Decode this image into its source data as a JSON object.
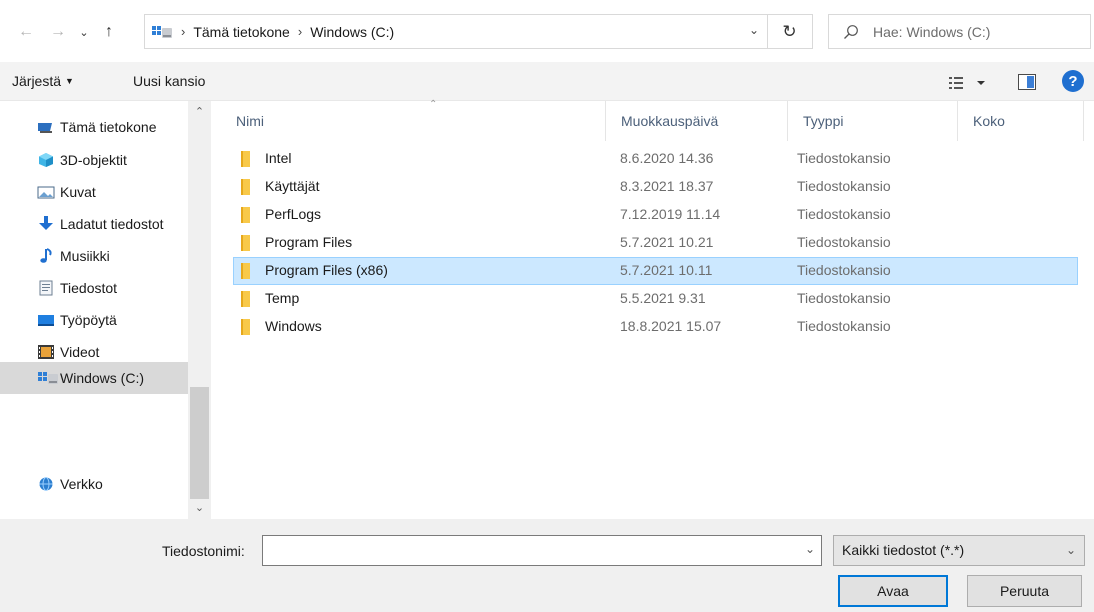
{
  "address": {
    "back_icon": "back-arrow-icon",
    "forward_icon": "forward-arrow-icon",
    "up_icon": "up-arrow-icon",
    "crumbs": [
      "Tämä tietokone",
      "Windows (C:)"
    ],
    "refresh_icon": "refresh-icon",
    "search_placeholder": "Hae: Windows (C:)"
  },
  "toolbar": {
    "organize_label": "Järjestä",
    "new_folder_label": "Uusi kansio",
    "help_label": "?"
  },
  "nav": {
    "items": [
      {
        "label": "Tämä tietokone",
        "icon": "computer-icon"
      },
      {
        "label": "3D-objektit",
        "icon": "3d-objects-icon"
      },
      {
        "label": "Kuvat",
        "icon": "pictures-icon"
      },
      {
        "label": "Ladatut tiedostot",
        "icon": "downloads-icon"
      },
      {
        "label": "Musiikki",
        "icon": "music-icon"
      },
      {
        "label": "Tiedostot",
        "icon": "documents-icon"
      },
      {
        "label": "Työpöytä",
        "icon": "desktop-icon"
      },
      {
        "label": "Videot",
        "icon": "videos-icon"
      },
      {
        "label": "Windows (C:)",
        "icon": "drive-icon"
      },
      {
        "label": "Verkko",
        "icon": "network-icon"
      }
    ],
    "selected": "Windows (C:)"
  },
  "list": {
    "headers": {
      "name": "Nimi",
      "modified": "Muokkauspäivä",
      "type": "Tyyppi",
      "size": "Koko"
    },
    "rows": [
      {
        "name": "Intel",
        "modified": "8.6.2020 14.36",
        "type": "Tiedostokansio",
        "size": ""
      },
      {
        "name": "Käyttäjät",
        "modified": "8.3.2021 18.37",
        "type": "Tiedostokansio",
        "size": ""
      },
      {
        "name": "PerfLogs",
        "modified": "7.12.2019 11.14",
        "type": "Tiedostokansio",
        "size": ""
      },
      {
        "name": "Program Files",
        "modified": "5.7.2021 10.21",
        "type": "Tiedostokansio",
        "size": ""
      },
      {
        "name": "Program Files (x86)",
        "modified": "5.7.2021 10.11",
        "type": "Tiedostokansio",
        "size": ""
      },
      {
        "name": "Temp",
        "modified": "5.5.2021 9.31",
        "type": "Tiedostokansio",
        "size": ""
      },
      {
        "name": "Windows",
        "modified": "18.8.2021 15.07",
        "type": "Tiedostokansio",
        "size": ""
      }
    ],
    "selected_row": "Program Files (x86)"
  },
  "bottom": {
    "filename_label": "Tiedostonimi:",
    "filename_value": "",
    "filter_value": "Kaikki tiedostot (*.*)",
    "open_label": "Avaa",
    "cancel_label": "Peruuta"
  },
  "colors": {
    "selection_bg": "#cce8ff",
    "selection_border": "#99d1ff",
    "nav_selected_bg": "#d9d9d9",
    "accent": "#0078d7",
    "folder": "#f8c94a"
  }
}
